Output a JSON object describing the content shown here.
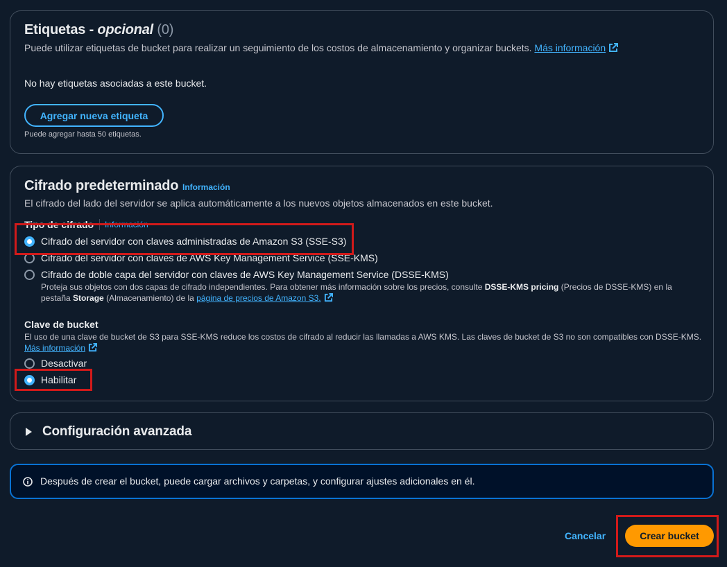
{
  "tags": {
    "title": "Etiquetas - ",
    "title_optional": "opcional",
    "count": "(0)",
    "description": "Puede utilizar etiquetas de bucket para realizar un seguimiento de los costos de almacenamiento y organizar buckets.",
    "more_info_link": "Más información",
    "empty_text": "No hay etiquetas asociadas a este bucket.",
    "add_button": "Agregar nueva etiqueta",
    "limit_hint": "Puede agregar hasta 50 etiquetas."
  },
  "encryption": {
    "title": "Cifrado predeterminado",
    "info_link": "Información",
    "description": "El cifrado del lado del servidor se aplica automáticamente a los nuevos objetos almacenados en este bucket.",
    "type_label": "Tipo de cifrado",
    "type_info_link": "Información",
    "options": [
      {
        "label": "Cifrado del servidor con claves administradas de Amazon S3 (SSE-S3)",
        "selected": true
      },
      {
        "label": "Cifrado del servidor con claves de AWS Key Management Service (SSE-KMS)",
        "selected": false
      },
      {
        "label": "Cifrado de doble capa del servidor con claves de AWS Key Management Service (DSSE-KMS)",
        "selected": false
      }
    ],
    "dsse_desc_1": "Proteja sus objetos con dos capas de cifrado independientes. Para obtener más información sobre los precios, consulte ",
    "dsse_desc_bold": "DSSE-KMS pricing",
    "dsse_desc_2": " (Precios de DSSE-KMS) en la",
    "dsse_desc_3": "pestaña ",
    "dsse_desc_storage": "Storage",
    "dsse_desc_4": " (Almacenamiento) de la ",
    "dsse_pricing_link": "página de precios de Amazon S3.",
    "bucket_key_label": "Clave de bucket",
    "bucket_key_desc": "El uso de una clave de bucket de S3 para SSE-KMS reduce los costos de cifrado al reducir las llamadas a AWS KMS. Las claves de bucket de S3 no son compatibles con DSSE-KMS.",
    "bucket_key_more_info": "Más información",
    "bucket_key_options": [
      {
        "label": "Desactivar",
        "selected": false
      },
      {
        "label": "Habilitar",
        "selected": true
      }
    ]
  },
  "advanced": {
    "title": "Configuración avanzada"
  },
  "alert": {
    "text": "Después de crear el bucket, puede cargar archivos y carpetas, y configurar ajustes adicionales en él."
  },
  "footer": {
    "cancel": "Cancelar",
    "create": "Crear bucket"
  },
  "colors": {
    "background": "#0f1b2a",
    "link": "#42b4ff",
    "primary_button": "#ff9900",
    "highlight": "#d11a1a"
  }
}
